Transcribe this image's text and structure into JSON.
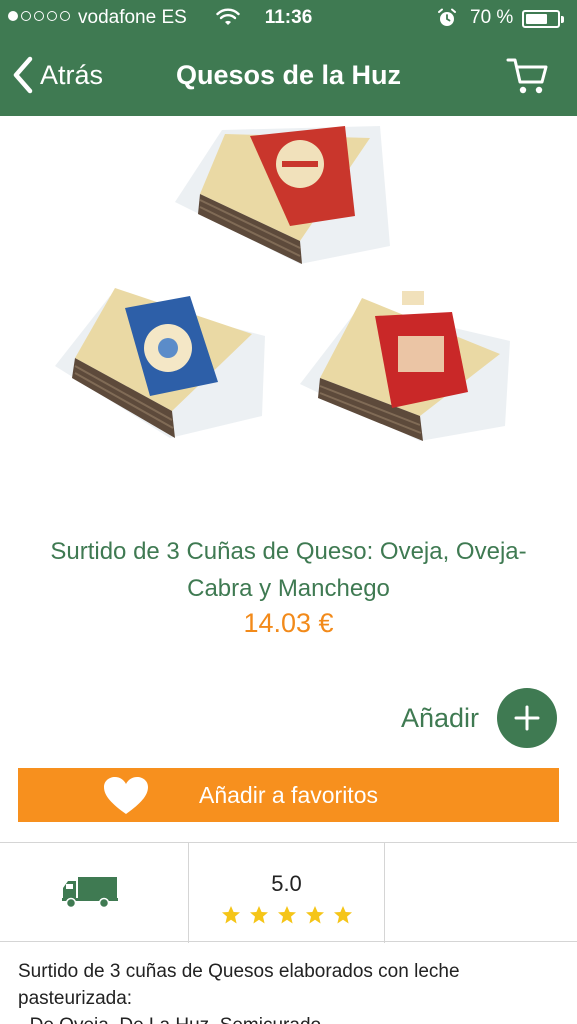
{
  "status_bar": {
    "carrier": "vodafone ES",
    "time": "11:36",
    "battery_percent": "70 %",
    "battery_level": 0.7,
    "signal_bars_filled": 1,
    "signal_bars_total": 5
  },
  "nav": {
    "back_label": "Atrás",
    "title": "Quesos de la Huz",
    "cart_icon": "cart-icon"
  },
  "product": {
    "name": "Surtido de 3 Cuñas de Queso:  Oveja, Oveja-Cabra y Manchego",
    "price": "14.03 €",
    "add_label": "Añadir",
    "favorite_label": "Añadir a favoritos",
    "rating": "5.0",
    "stars": 5,
    "description_line1": "Surtido de 3 cuñas de Quesos elaborados con leche pasteurizada:",
    "description_line2": "- De Oveja, De La Huz, Semicurado"
  },
  "colors": {
    "brand_green": "#3f7a52",
    "price_orange": "#f28a1a",
    "favorite_orange": "#f7901e",
    "star_yellow": "#f5c518"
  }
}
